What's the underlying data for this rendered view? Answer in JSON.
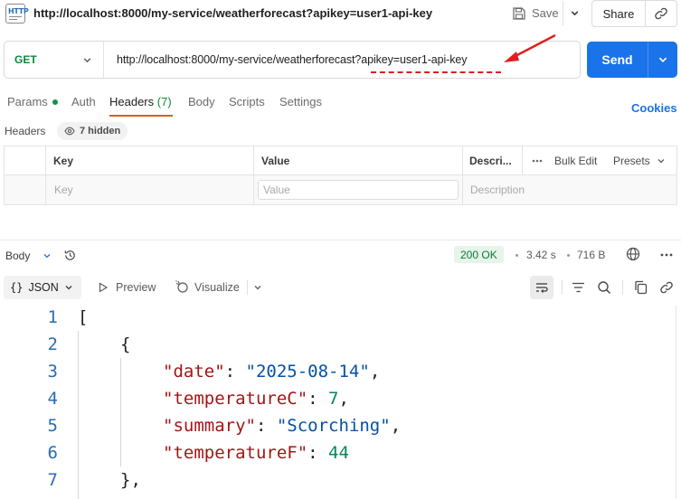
{
  "header": {
    "request_title": "http://localhost:8000/my-service/weatherforecast?apikey=user1-api-key",
    "save_label": "Save",
    "share_label": "Share",
    "icons": {
      "file": "http-file-icon",
      "save": "floppy-disk-icon",
      "link": "link-icon"
    }
  },
  "url_bar": {
    "method": "GET",
    "url": "http://localhost:8000/my-service/weatherforecast?apikey=user1-api-key",
    "send_label": "Send",
    "annotation_color": "#e11d1d"
  },
  "request_tabs": {
    "items": [
      {
        "label": "Params",
        "has_dot": true
      },
      {
        "label": "Auth"
      },
      {
        "label": "Headers",
        "count": "(7)",
        "active": true
      },
      {
        "label": "Body"
      },
      {
        "label": "Scripts"
      },
      {
        "label": "Settings"
      }
    ],
    "cookies_label": "Cookies"
  },
  "headers_section": {
    "label": "Headers",
    "hidden_label": "7 hidden",
    "columns": {
      "key": "Key",
      "value": "Value",
      "description": "Descri..."
    },
    "bulk_edit_label": "Bulk Edit",
    "presets_label": "Presets",
    "placeholders": {
      "key": "Key",
      "value": "Value",
      "description": "Description"
    }
  },
  "response": {
    "body_label": "Body",
    "status": "200 OK",
    "time": "3.42 s",
    "size": "716 B",
    "format_label": "JSON",
    "preview_label": "Preview",
    "visualize_label": "Visualize",
    "lines": [
      {
        "num": "1",
        "indent": 0,
        "tokens": [
          {
            "t": "punc",
            "v": "["
          }
        ]
      },
      {
        "num": "2",
        "indent": 1,
        "tokens": [
          {
            "t": "punc",
            "v": "{"
          }
        ]
      },
      {
        "num": "3",
        "indent": 2,
        "tokens": [
          {
            "t": "key",
            "v": "\"date\""
          },
          {
            "t": "punc",
            "v": ": "
          },
          {
            "t": "str",
            "v": "\"2025-08-14\""
          },
          {
            "t": "punc",
            "v": ","
          }
        ]
      },
      {
        "num": "4",
        "indent": 2,
        "tokens": [
          {
            "t": "key",
            "v": "\"temperatureC\""
          },
          {
            "t": "punc",
            "v": ": "
          },
          {
            "t": "num",
            "v": "7"
          },
          {
            "t": "punc",
            "v": ","
          }
        ]
      },
      {
        "num": "5",
        "indent": 2,
        "tokens": [
          {
            "t": "key",
            "v": "\"summary\""
          },
          {
            "t": "punc",
            "v": ": "
          },
          {
            "t": "str",
            "v": "\"Scorching\""
          },
          {
            "t": "punc",
            "v": ","
          }
        ]
      },
      {
        "num": "6",
        "indent": 2,
        "tokens": [
          {
            "t": "key",
            "v": "\"temperatureF\""
          },
          {
            "t": "punc",
            "v": ": "
          },
          {
            "t": "num",
            "v": "44"
          }
        ]
      },
      {
        "num": "7",
        "indent": 1,
        "tokens": [
          {
            "t": "punc",
            "v": "},"
          }
        ]
      }
    ],
    "colors": {
      "key": "#a31515",
      "string": "#0451a5",
      "number": "#098658",
      "line_number": "#2b6cb0"
    }
  },
  "theme": {
    "accent": "#1a73e8",
    "method_get": "#0b8a3a",
    "tab_active_underline": "#e05a2a",
    "status_ok_bg": "#e6f4ea"
  }
}
